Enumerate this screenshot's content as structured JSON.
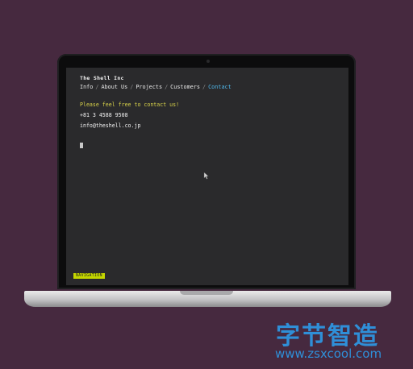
{
  "site": {
    "title": "The Shell Inc",
    "nav": [
      {
        "label": "Info",
        "active": false
      },
      {
        "label": "About Us",
        "active": false
      },
      {
        "label": "Projects",
        "active": false
      },
      {
        "label": "Customers",
        "active": false
      },
      {
        "label": "Contact",
        "active": true
      }
    ],
    "separator": "/",
    "contact": {
      "intro": "Please feel free to contact us!",
      "phone": "+81 3 4588 9508",
      "email": "info@theshell.co.jp"
    },
    "navigation_badge": "NAVIGATION"
  },
  "watermark": {
    "text": "字节智造",
    "url": "www.zsxcool.com"
  },
  "colors": {
    "background": "#46293f",
    "screen": "#2a2a2c",
    "active_link": "#4fb6e8",
    "intro_text": "#d8d24a",
    "badge": "#c4d600",
    "watermark": "#2f8fd8"
  },
  "icons": {
    "text_cursor": "block-cursor-icon",
    "mouse_pointer": "mouse-pointer-icon"
  }
}
